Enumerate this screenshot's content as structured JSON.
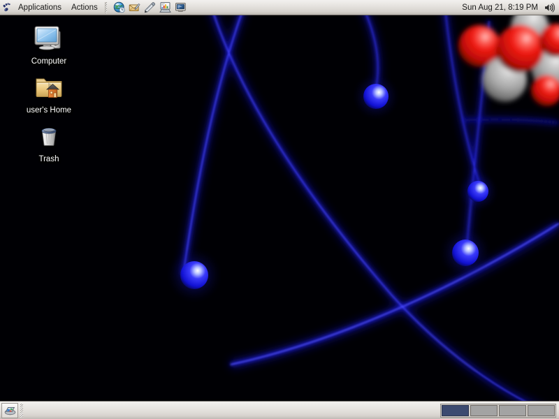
{
  "desktop": {
    "environment": "GNOME",
    "wallpaper": {
      "name": "atom-orbitals-wallpaper",
      "description": "Dark space background with glowing blue electron spheres on blue orbital arcs and a red-and-gray molecular nucleus cluster in the upper right corner",
      "background_color": "#000005",
      "orbit_color": "#1a1ae0",
      "electron_color": "#2222ee",
      "nucleus_colors": [
        "#ee1111",
        "#b0b0b0"
      ]
    },
    "icons": [
      {
        "name": "computer",
        "label": "Computer",
        "icon": "computer-monitor-icon"
      },
      {
        "name": "home",
        "label": "user's Home",
        "icon": "home-folder-icon"
      },
      {
        "name": "trash",
        "label": "Trash",
        "icon": "trash-can-icon"
      }
    ]
  },
  "top_panel": {
    "logo_icon": "gnome-foot-icon",
    "menus": [
      {
        "name": "applications",
        "label": "Applications"
      },
      {
        "name": "actions",
        "label": "Actions"
      }
    ],
    "launchers": [
      {
        "name": "web-browser",
        "icon": "globe-browser-icon",
        "tooltip": "Web Browser"
      },
      {
        "name": "email-client",
        "icon": "envelope-mail-icon",
        "tooltip": "Email"
      },
      {
        "name": "text-editor",
        "icon": "pen-writing-icon",
        "tooltip": "Text Editor"
      },
      {
        "name": "presentation",
        "icon": "chart-presentation-icon",
        "tooltip": "Presentation"
      },
      {
        "name": "terminal",
        "icon": "terminal-screen-icon",
        "tooltip": "Terminal"
      }
    ],
    "clock": {
      "label": "Sun Aug 21,  8:19 PM"
    },
    "volume_icon": "speaker-volume-icon",
    "colors": {
      "panel_top": "#f3f1ef",
      "panel_bottom": "#bdb8b2",
      "text": "#1a1a1a"
    }
  },
  "bottom_panel": {
    "show_desktop": {
      "name": "show-desktop",
      "icon": "show-desktop-icon",
      "tooltip": "Hide all windows and show the desktop"
    },
    "window_list": {
      "items": []
    },
    "workspaces": [
      {
        "name": "workspace-1",
        "label": "1",
        "active": true
      },
      {
        "name": "workspace-2",
        "label": "2",
        "active": false
      },
      {
        "name": "workspace-3",
        "label": "3",
        "active": false
      },
      {
        "name": "workspace-4",
        "label": "4",
        "active": false
      }
    ],
    "colors": {
      "active_workspace": "#3c4a70",
      "inactive_workspace": "#a3a3a3"
    }
  }
}
